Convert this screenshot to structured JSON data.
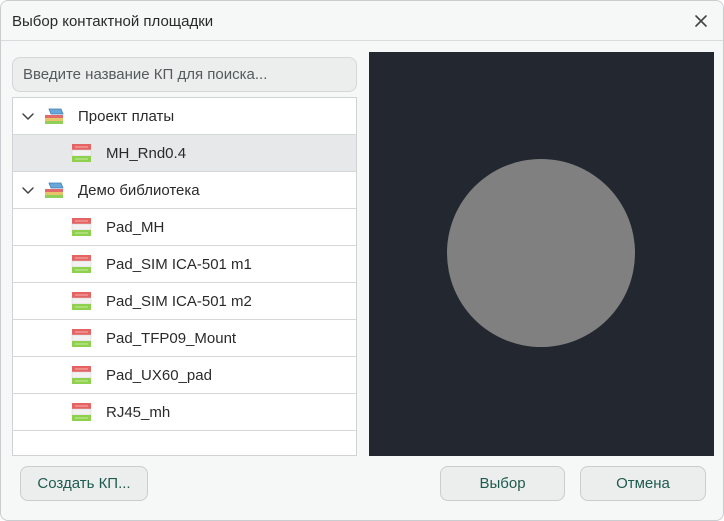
{
  "dialog": {
    "title": "Выбор контактной площадки"
  },
  "search": {
    "placeholder": "Введите название КП для поиска..."
  },
  "tree": {
    "groups": [
      {
        "label": "Проект платы",
        "expanded": true,
        "items": [
          {
            "label": "MH_Rnd0.4",
            "selected": true
          }
        ]
      },
      {
        "label": "Демо библиотека",
        "expanded": true,
        "items": [
          {
            "label": "Pad_MH"
          },
          {
            "label": "Pad_SIM ICA-501 m1"
          },
          {
            "label": "Pad_SIM ICA-501 m2"
          },
          {
            "label": "Pad_TFP09_Mount"
          },
          {
            "label": "Pad_UX60_pad"
          },
          {
            "label": "RJ45_mh"
          }
        ]
      }
    ]
  },
  "preview": {
    "background": "#232830",
    "pad_color": "#808080",
    "pad_shape": "circle"
  },
  "buttons": {
    "create": "Создать КП...",
    "select": "Выбор",
    "cancel": "Отмена"
  },
  "colors": {
    "button_text": "#1e5a4e",
    "selected_row": "#e6e8e9"
  }
}
